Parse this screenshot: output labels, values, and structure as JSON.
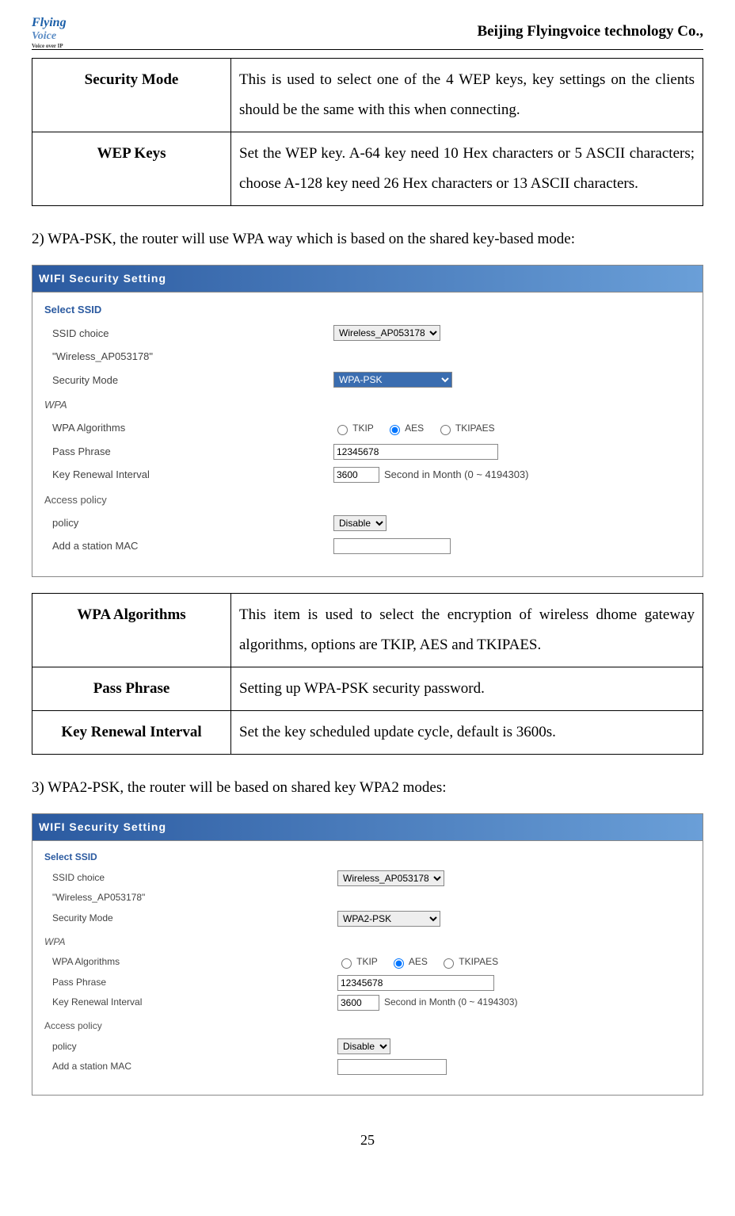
{
  "header": {
    "logo_main": "Flying",
    "logo_sub": "Voice",
    "logo_tag": "Voice over IP",
    "company": "Beijing Flyingvoice technology Co.,"
  },
  "table1": {
    "rows": [
      {
        "label": "Security Mode",
        "desc": "This is used to select one of the 4 WEP keys, key settings on the clients should be the same with this when connecting."
      },
      {
        "label": "WEP Keys",
        "desc": "Set the WEP key. A-64 key need 10 Hex characters or 5 ASCII characters; choose A-128 key need 26 Hex characters or 13 ASCII characters."
      }
    ]
  },
  "para2": "2) WPA-PSK, the router will use WPA way which is based on the shared key-based mode:",
  "screenshot1": {
    "title": "WIFI Security Setting",
    "fieldset": "Select SSID",
    "ssid_choice_label": "SSID choice",
    "ssid_value": "Wireless_AP053178",
    "ssid_quoted": "\"Wireless_AP053178\"",
    "security_mode_label": "Security Mode",
    "security_mode_value": "WPA-PSK",
    "wpa_section": "WPA",
    "wpa_algo_label": "WPA Algorithms",
    "algo_tkip": "TKIP",
    "algo_aes": "AES",
    "algo_tkipaes": "TKIPAES",
    "pass_label": "Pass Phrase",
    "pass_value": "12345678",
    "key_renew_label": "Key Renewal Interval",
    "key_renew_value": "3600",
    "key_renew_unit": "Second in Month   (0 ~ 4194303)",
    "access_policy": "Access policy",
    "policy_label": "policy",
    "policy_value": "Disable",
    "add_station": "Add a station MAC"
  },
  "table2": {
    "rows": [
      {
        "label": "WPA Algorithms",
        "desc": "This item is used to select the encryption of wireless dhome gateway algorithms, options are TKIP, AES and TKIPAES."
      },
      {
        "label": "Pass Phrase",
        "desc": "Setting up WPA-PSK security password."
      },
      {
        "label": "Key Renewal Interval",
        "desc": "Set the key scheduled update cycle, default is 3600s."
      }
    ]
  },
  "para3": "3) WPA2-PSK, the router will be based on shared key WPA2 modes:",
  "screenshot2": {
    "title": "WIFI Security Setting",
    "fieldset": "Select SSID",
    "ssid_choice_label": "SSID choice",
    "ssid_value": "Wireless_AP053178",
    "ssid_quoted": "\"Wireless_AP053178\"",
    "security_mode_label": "Security Mode",
    "security_mode_value": "WPA2-PSK",
    "wpa_section": "WPA",
    "wpa_algo_label": "WPA Algorithms",
    "algo_tkip": "TKIP",
    "algo_aes": "AES",
    "algo_tkipaes": "TKIPAES",
    "pass_label": "Pass Phrase",
    "pass_value": "12345678",
    "key_renew_label": "Key Renewal Interval",
    "key_renew_value": "3600",
    "key_renew_unit": "Second in Month   (0 ~ 4194303)",
    "access_policy": "Access policy",
    "policy_label": "policy",
    "policy_value": "Disable",
    "add_station": "Add a station MAC"
  },
  "page_number": "25"
}
